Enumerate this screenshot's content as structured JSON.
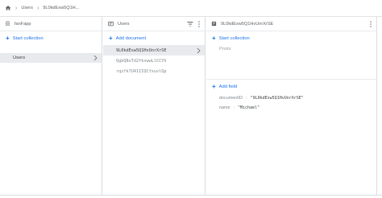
{
  "breadcrumb": {
    "collection": "Users",
    "document": "9L0kdExw5Q1H..."
  },
  "col1": {
    "project": "fanFapp",
    "start_collection": "Start collection",
    "items": [
      "Users"
    ]
  },
  "col2": {
    "title": "Users",
    "add_document": "Add document",
    "documents": [
      "9L0kdExw5Q1HvUnrXrSE",
      "QgbQ8uTd2fkxwwLlCCYh",
      "rqzfk7U41IIQCfxuvlQp"
    ]
  },
  "col3": {
    "title": "9L0kdExw5Q1HvUnrXrSE",
    "start_collection": "Start collection",
    "subcollections": [
      "Posts"
    ],
    "add_field": "Add field",
    "fields": [
      {
        "name": "documentID",
        "sep": ":",
        "value": "\"9L0kdExw5Q1HvUnrXrSE\""
      },
      {
        "name": "name",
        "sep": ":",
        "value": "\"Michael\""
      }
    ]
  },
  "colors": {
    "accent": "#1a73e8",
    "selected_bg": "#e8eaed",
    "border": "#dadce0"
  },
  "icons": [
    "home-icon",
    "chevron-right-icon",
    "database-icon",
    "collection-icon",
    "document-icon",
    "filter-icon",
    "more-vert-icon"
  ]
}
